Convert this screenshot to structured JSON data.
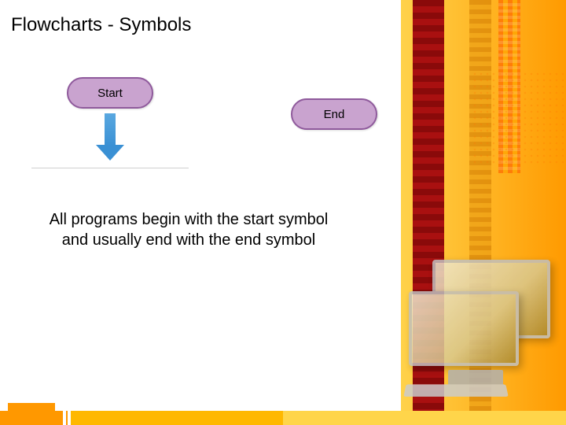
{
  "title": "Flowcharts - Symbols",
  "symbols": {
    "start_label": "Start",
    "end_label": "End"
  },
  "description": "All programs begin with the start symbol and usually end with the end symbol"
}
